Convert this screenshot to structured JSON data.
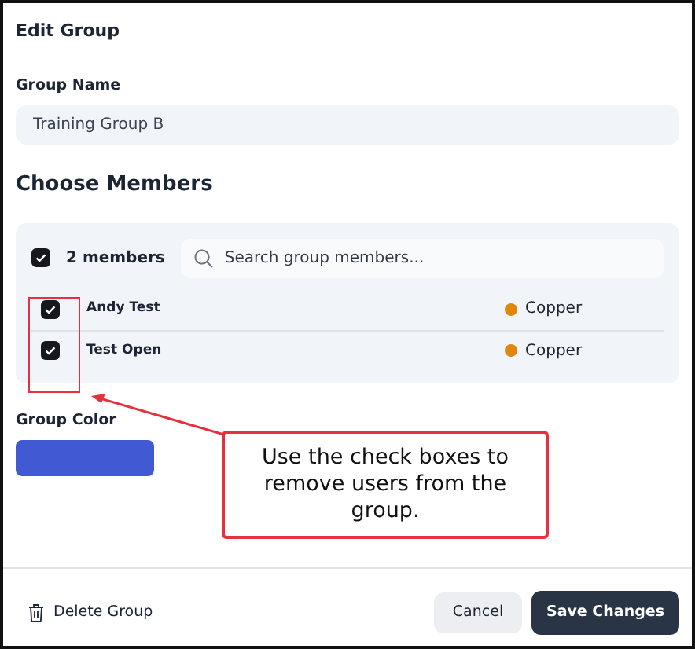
{
  "dialog": {
    "title": "Edit Group"
  },
  "group_name": {
    "label": "Group Name",
    "value": "Training Group B"
  },
  "members": {
    "heading": "Choose Members",
    "select_all": {
      "checked": true,
      "label": "2 members"
    },
    "search": {
      "placeholder": "Search group members..."
    },
    "rows": [
      {
        "name": "Andy Test",
        "checked": true,
        "tier": "Copper",
        "color": "#e0860b"
      },
      {
        "name": "Test Open",
        "checked": true,
        "tier": "Copper",
        "color": "#e0860b"
      }
    ]
  },
  "group_color": {
    "label": "Group Color",
    "color": "#4159d3"
  },
  "annotation": {
    "text": "Use the check boxes to remove users from the group."
  },
  "footer": {
    "delete": "Delete Group",
    "cancel": "Cancel",
    "save": "Save Changes"
  }
}
